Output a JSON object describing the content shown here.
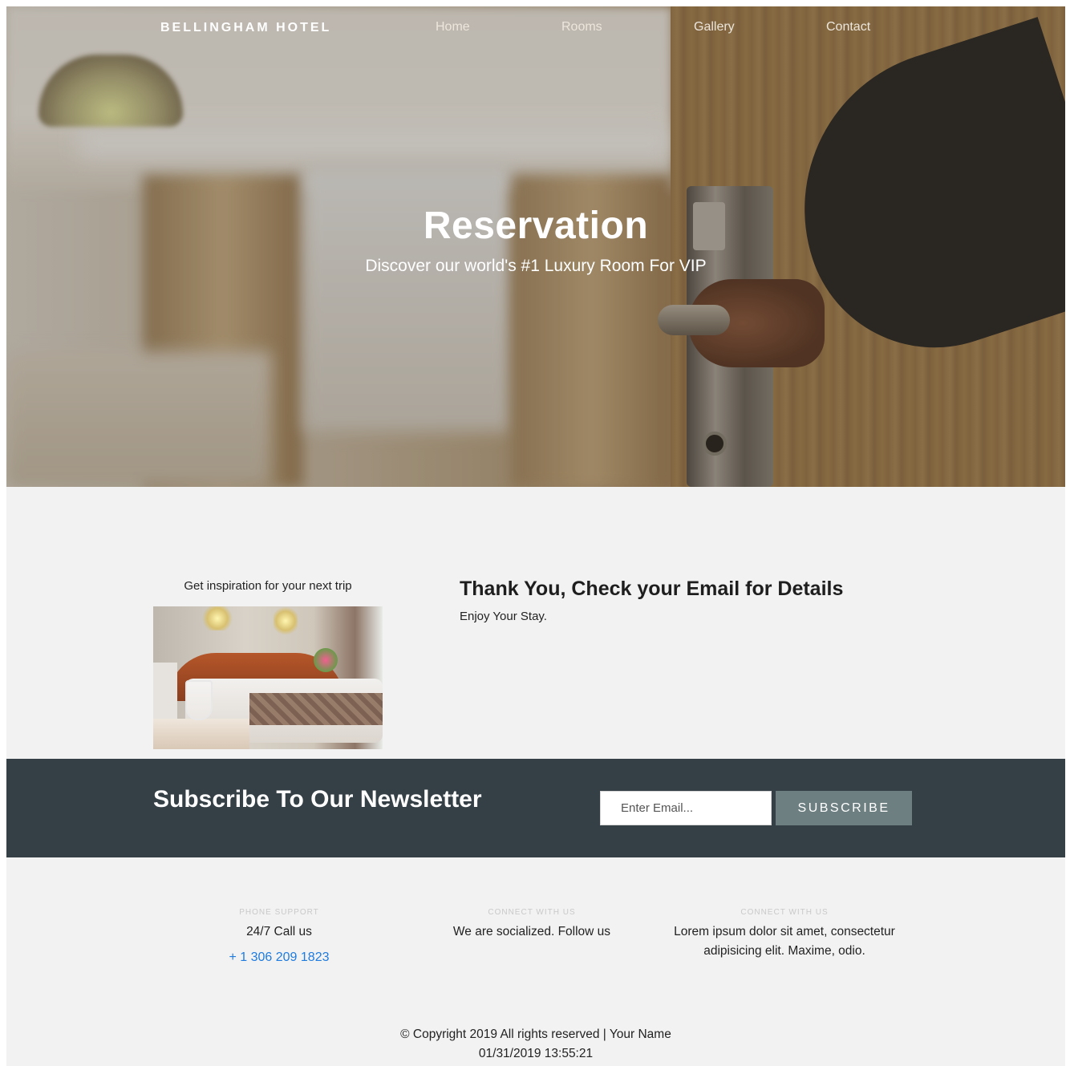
{
  "nav": {
    "brand": "BELLINGHAM HOTEL",
    "links": [
      "Home",
      "Rooms",
      "Gallery",
      "Contact"
    ]
  },
  "hero": {
    "title": "Reservation",
    "subtitle": "Discover our world's #1 Luxury Room For VIP"
  },
  "inspiration": {
    "label": "Get inspiration for your next trip"
  },
  "confirmation": {
    "title": "Thank You, Check your Email for Details",
    "message": "Enjoy Your Stay."
  },
  "newsletter": {
    "title": "Subscribe To Our Newsletter",
    "email_placeholder": "Enter Email...",
    "button_label": "SUBSCRIBE"
  },
  "footer": {
    "columns": [
      {
        "kicker": "PHONE SUPPORT",
        "text": "24/7 Call us",
        "phone": "+ 1 306 209 1823"
      },
      {
        "kicker": "CONNECT WITH US",
        "text": "We are socialized. Follow us"
      },
      {
        "kicker": "CONNECT WITH US",
        "text": "Lorem ipsum dolor sit amet, consectetur adipisicing elit. Maxime, odio."
      }
    ],
    "copyright": "© Copyright 2019 All rights reserved | Your Name",
    "timestamp": "01/31/2019 13:55:21"
  },
  "colors": {
    "newsletter_bg": "#343f46",
    "subscribe_button": "#6e7f82",
    "page_bg": "#f2f2f2",
    "phone_link": "#1e7be0"
  }
}
